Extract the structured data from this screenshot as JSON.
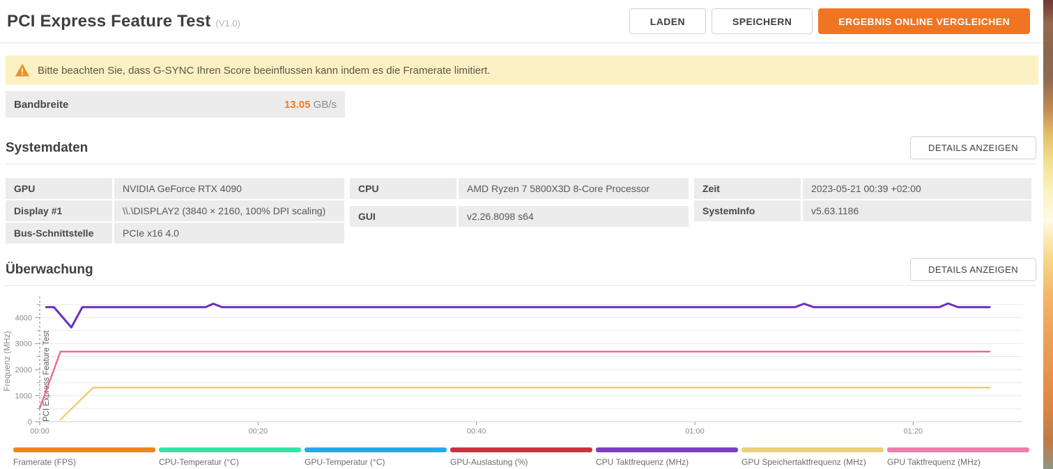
{
  "header": {
    "title": "PCI Express Feature Test",
    "version": "(V1.0)",
    "buttons": {
      "load": "LADEN",
      "save": "SPEICHERN",
      "compare": "ERGEBNIS ONLINE VERGLEICHEN"
    },
    "accent_color": "#ef7522"
  },
  "warning": {
    "text": "Bitte beachten Sie, dass G-SYNC Ihren Score beeinflussen kann indem es die Framerate limitiert.",
    "icon": "warning-triangle",
    "icon_color": "#e8932e",
    "background_color": "#fbf1c3"
  },
  "result": {
    "label": "Bandbreite",
    "value": "13.05",
    "unit": "GB/s",
    "value_color": "#ef7d1f"
  },
  "sections": {
    "system": {
      "title": "Systemdaten",
      "details_button": "DETAILS ANZEIGEN"
    },
    "monitoring": {
      "title": "Überwachung",
      "details_button": "DETAILS ANZEIGEN"
    }
  },
  "system_table": {
    "columns": [
      {
        "rows": [
          {
            "label": "GPU",
            "value": "NVIDIA GeForce RTX 4090"
          },
          {
            "label": "Display #1",
            "value": "\\\\.\\DISPLAY2 (3840 × 2160, 100% DPI scaling)"
          },
          {
            "label": "Bus-Schnittstelle",
            "value": "PCIe x16 4.0"
          }
        ]
      },
      {
        "rows": [
          {
            "label": "CPU",
            "value": "AMD Ryzen 7 5800X3D 8-Core Processor"
          },
          {
            "label": "GUI",
            "value": "v2.26.8098 s64"
          }
        ]
      },
      {
        "rows": [
          {
            "label": "Zeit",
            "value": "2023-05-21 00:39 +02:00"
          },
          {
            "label": "SystemInfo",
            "value": "v5.63.1186"
          }
        ]
      }
    ]
  },
  "chart_data": {
    "type": "line",
    "title": "",
    "xlabel": "",
    "ylabel": "Frequenz (MHz)",
    "ylim": [
      0,
      4650
    ],
    "xlim_seconds": [
      0,
      90
    ],
    "grid": true,
    "grid_interval": 500,
    "y_ticks": [
      0,
      1000,
      2000,
      3000,
      4000
    ],
    "x_ticks": [
      {
        "t": 0,
        "label": "00:00"
      },
      {
        "t": 20,
        "label": "00:20"
      },
      {
        "t": 40,
        "label": "00:40"
      },
      {
        "t": 60,
        "label": "01:00"
      },
      {
        "t": 80,
        "label": "01:20"
      }
    ],
    "event_marker": {
      "t": 0,
      "label": "PCI Express Feature Test"
    },
    "legend_position": "bottom",
    "legend": [
      {
        "name": "Framerate (FPS)",
        "color": "#ee8420"
      },
      {
        "name": "CPU-Temperatur (°C)",
        "color": "#35e3a5"
      },
      {
        "name": "GPU-Temperatur (°C)",
        "color": "#2ba7e8"
      },
      {
        "name": "GPU-Auslastung (%)",
        "color": "#c9343c"
      },
      {
        "name": "CPU Taktfrequenz (MHz)",
        "color": "#7c3fc3"
      },
      {
        "name": "GPU Speichertaktfrequenz (MHz)",
        "color": "#ecd07a"
      },
      {
        "name": "GPU Taktfrequenz (MHz)",
        "color": "#ed7fae"
      }
    ],
    "series": [
      {
        "name": "CPU Taktfrequenz (MHz)",
        "color": "#6c2fbe",
        "width": 3,
        "points": [
          [
            0.6,
            4400
          ],
          [
            1.3,
            4400
          ],
          [
            2.9,
            3620
          ],
          [
            3.9,
            4400
          ],
          [
            15.2,
            4400
          ],
          [
            15.9,
            4530
          ],
          [
            16.7,
            4400
          ],
          [
            69.2,
            4400
          ],
          [
            70.0,
            4530
          ],
          [
            70.9,
            4400
          ],
          [
            82.4,
            4400
          ],
          [
            83.2,
            4540
          ],
          [
            84.1,
            4400
          ],
          [
            87,
            4400
          ]
        ]
      },
      {
        "name": "GPU Taktfrequenz (MHz)",
        "color": "#ed6a9e",
        "width": 2.5,
        "points": [
          [
            0,
            520
          ],
          [
            1.9,
            2690
          ],
          [
            87,
            2690
          ]
        ]
      },
      {
        "name": "GPU Speichertaktfrequenz (MHz)",
        "color": "#eecd74",
        "width": 2.5,
        "points": [
          [
            1.9,
            80
          ],
          [
            4.9,
            1310
          ],
          [
            87,
            1310
          ]
        ]
      }
    ]
  }
}
